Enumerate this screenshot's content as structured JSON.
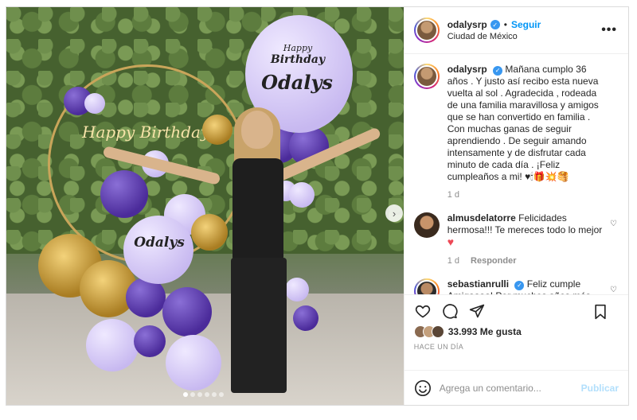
{
  "post": {
    "username": "odalysrp",
    "follow_label": "Seguir",
    "location": "Ciudad de México",
    "more_label": "•••",
    "separator": "•"
  },
  "photo": {
    "hoop_text": "Happy Birthday",
    "balloon_top_line1": "Happy",
    "balloon_top_line2": "Birthday",
    "balloon_top_name": "Odalys",
    "balloon_mid_name": "Odalys",
    "next_glyph": "›",
    "slide_count": 6,
    "active_slide": 1
  },
  "caption": {
    "username": "odalysrp",
    "text": "Mañana cumplo 36 años . Y justo así recibo esta nueva vuelta al sol . Agradecida , rodeada de una familia maravillosa y amigos que se han convertido en familia . Con muchas ganas de seguir aprendiendo . De seguir amando intensamente y de disfrutar cada minuto de cada día . ¡Feliz cumpleaños a mi! ♥🕯🎁💥🥞",
    "time": "1 d"
  },
  "comments": [
    {
      "username": "almusdelatorre",
      "text": "Felicidades hermosa!!! Te mereces todo lo mejor",
      "emoji": "♥",
      "time": "1 d",
      "reply_label": "Responder"
    },
    {
      "username": "sebastianrulli",
      "text": "Feliz cumple Amigaaaa! Por muchos años más"
    }
  ],
  "actions": {
    "likes_count": "33.993",
    "likes_label": "Me gusta",
    "time_ago": "HACE UN DÍA"
  },
  "add_comment": {
    "placeholder": "Agrega un comentario...",
    "post_label": "Publicar"
  },
  "colors": {
    "accent": "#0095f6",
    "verified": "#3897f0",
    "purple_balloon": "#4b2b9a",
    "lilac_balloon": "#c7b8f0",
    "gold_balloon": "#c9a55a"
  }
}
